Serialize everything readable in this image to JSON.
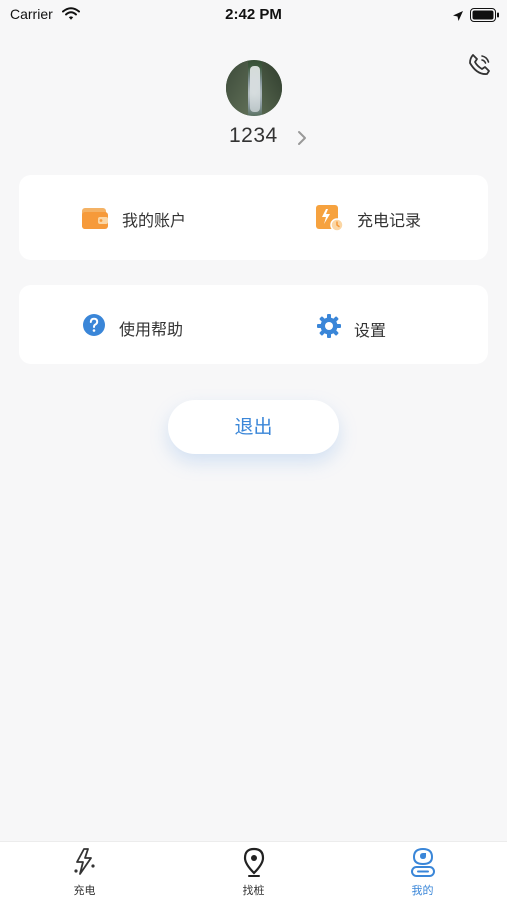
{
  "status_bar": {
    "carrier": "Carrier",
    "time": "2:42 PM"
  },
  "profile": {
    "username": "1234"
  },
  "menu": {
    "account_label": "我的账户",
    "records_label": "充电记录",
    "help_label": "使用帮助",
    "settings_label": "设置"
  },
  "logout_label": "退出",
  "tabs": [
    {
      "label": "充电",
      "icon": "charging-bolt-icon",
      "active": false
    },
    {
      "label": "找桩",
      "icon": "location-pin-icon",
      "active": false
    },
    {
      "label": "我的",
      "icon": "profile-icon",
      "active": true
    }
  ],
  "colors": {
    "accent": "#3a86d8",
    "orange": "#f6a23f",
    "background": "#f7f7f8"
  }
}
